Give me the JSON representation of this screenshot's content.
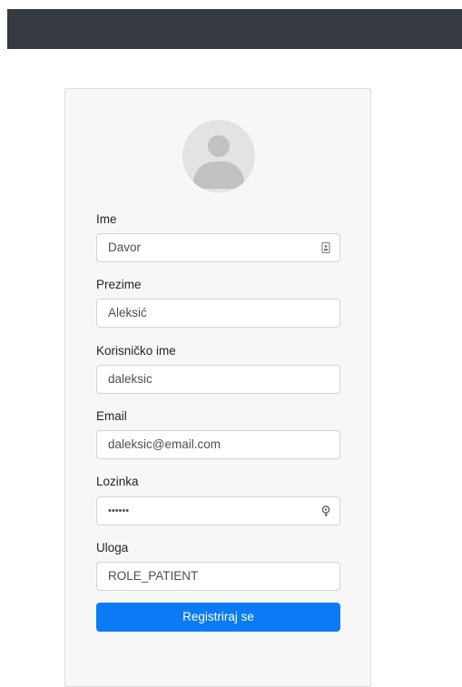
{
  "form": {
    "fields": [
      {
        "label": "Ime",
        "value": "Davor"
      },
      {
        "label": "Prezime",
        "value": "Aleksić"
      },
      {
        "label": "Korisničko ime",
        "value": "daleksic"
      },
      {
        "label": "Email",
        "value": "daleksic@email.com"
      },
      {
        "label": "Lozinka",
        "value": "••••••"
      },
      {
        "label": "Uloga",
        "value": "ROLE_PATIENT"
      }
    ],
    "submit_label": "Registriraj se"
  },
  "icons": {
    "ime_field": "contact-card-icon",
    "password_field": "key-icon",
    "avatar": "user-avatar-icon"
  },
  "colors": {
    "navbar": "#343a40",
    "primary_button": "#0a7bf5",
    "card_background": "#f7f7f7"
  }
}
